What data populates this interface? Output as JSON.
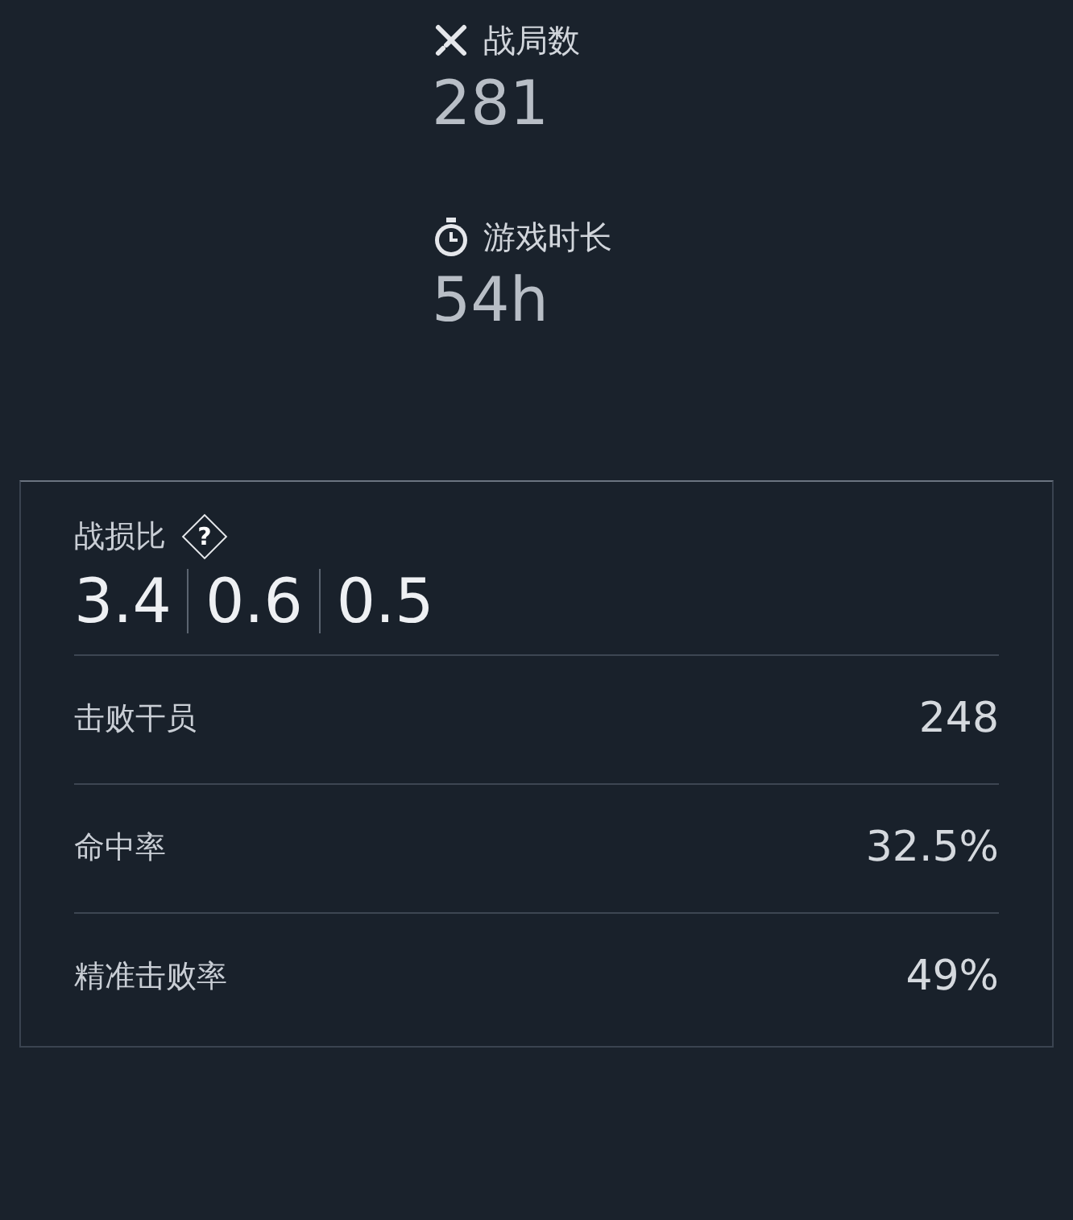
{
  "summary": [
    {
      "label": "战局数",
      "value": "281"
    },
    {
      "label": "游戏时长",
      "value": "54h"
    }
  ],
  "kd_panel": {
    "label": "战损比",
    "help_mark": "?",
    "ratios": [
      "3.4",
      "0.6",
      "0.5"
    ],
    "rows": [
      {
        "label": "击败干员",
        "value": "248"
      },
      {
        "label": "命中率",
        "value": "32.5%"
      },
      {
        "label": "精准击败率",
        "value": "49%"
      }
    ]
  }
}
